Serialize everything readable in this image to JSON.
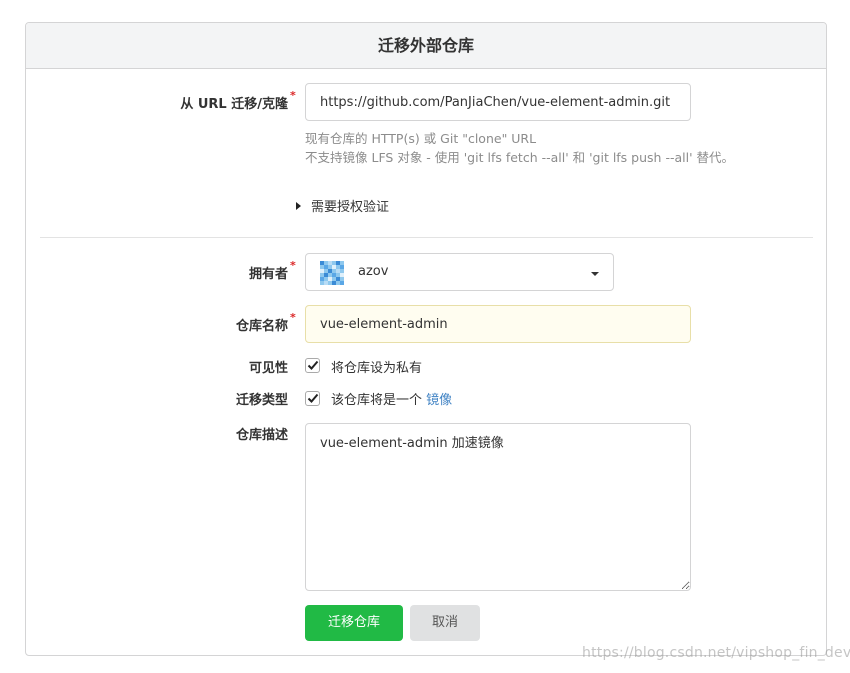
{
  "title": "迁移外部仓库",
  "clone_url": {
    "label": "从 URL 迁移/克隆",
    "required_mark": "*",
    "value": "https://github.com/PanJiaChen/vue-element-admin.git",
    "help_line1": "现有仓库的 HTTP(s) 或 Git \"clone\" URL",
    "help_line2": "不支持镜像 LFS 对象 - 使用 'git lfs fetch --all' 和 'git lfs push --all' 替代。"
  },
  "auth_toggle": {
    "label": "需要授权验证"
  },
  "owner": {
    "label": "拥有者",
    "required_mark": "*",
    "value": "azov"
  },
  "repo_name": {
    "label": "仓库名称",
    "required_mark": "*",
    "value": "vue-element-admin"
  },
  "visibility": {
    "label": "可见性",
    "checkbox_label": "将仓库设为私有",
    "checked": true
  },
  "migration_type": {
    "label": "迁移类型",
    "checkbox_label": "该仓库将是一个",
    "link_text": "镜像",
    "checked": true
  },
  "description": {
    "label": "仓库描述",
    "value": "vue-element-admin 加速镜像"
  },
  "buttons": {
    "submit": "迁移仓库",
    "cancel": "取消"
  },
  "watermark": "https://blog.csdn.net/vipshop_fin_dev",
  "colors": {
    "primary": "#21ba45",
    "link": "#4183c4",
    "required": "#db2828",
    "highlight_input": "#fffdf0"
  }
}
